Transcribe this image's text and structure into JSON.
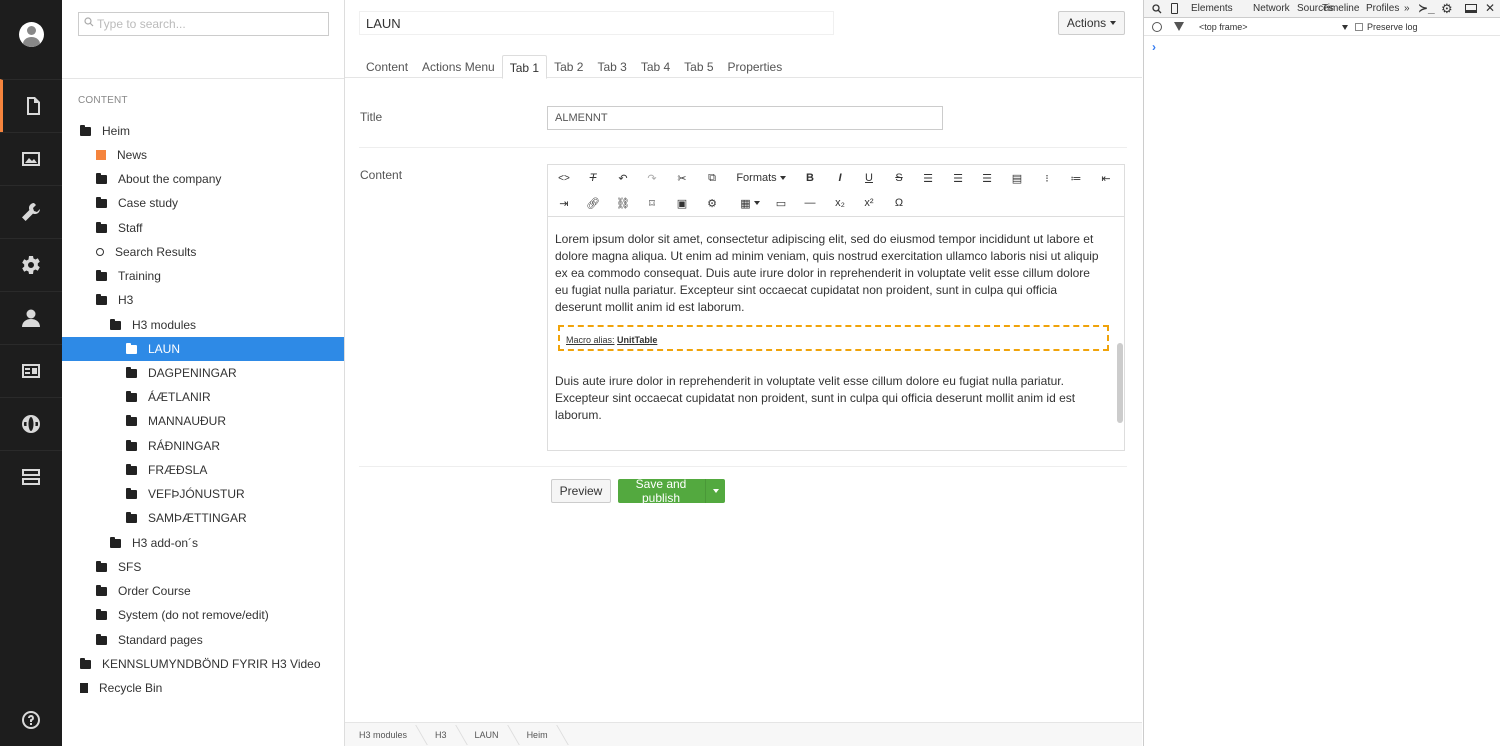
{
  "tree": {
    "search_placeholder": "Type to search...",
    "section": "CONTENT",
    "nodes": [
      {
        "label": "Heim",
        "icon": "home-icon"
      },
      {
        "label": "News",
        "icon": "box-icon"
      },
      {
        "label": "About the company",
        "icon": "folder-icon"
      },
      {
        "label": "Case study",
        "icon": "folder-icon"
      },
      {
        "label": "Staff",
        "icon": "folder-icon"
      },
      {
        "label": "Search Results",
        "icon": "search-icon"
      },
      {
        "label": "Training",
        "icon": "folder-icon"
      },
      {
        "label": "H3",
        "icon": "folder-icon"
      },
      {
        "label": "H3 modules",
        "icon": "folder-icon"
      },
      {
        "label": "LAUN",
        "icon": "folder-icon"
      },
      {
        "label": "DAGPENINGAR",
        "icon": "folder-icon"
      },
      {
        "label": "ÁÆTLANIR",
        "icon": "folder-icon"
      },
      {
        "label": "MANNAUÐUR",
        "icon": "folder-icon"
      },
      {
        "label": "RÁÐNINGAR",
        "icon": "folder-icon"
      },
      {
        "label": "FRÆÐSLA",
        "icon": "folder-icon"
      },
      {
        "label": "VEFÞJÓNUSTUR",
        "icon": "folder-icon"
      },
      {
        "label": "SAMÞÆTTINGAR",
        "icon": "folder-icon"
      },
      {
        "label": "H3 add-on´s",
        "icon": "folder-icon"
      },
      {
        "label": "SFS",
        "icon": "folder-icon"
      },
      {
        "label": "Order Course",
        "icon": "folder-icon"
      },
      {
        "label": "System (do not remove/edit)",
        "icon": "folder-icon"
      },
      {
        "label": "Standard pages",
        "icon": "folder-icon"
      },
      {
        "label": "KENNSLUMYNDBÖND FYRIR H3 Video",
        "icon": "folder-icon"
      },
      {
        "label": "Recycle Bin",
        "icon": "trash-icon"
      }
    ]
  },
  "main": {
    "node_name": "LAUN",
    "actions_label": "Actions",
    "tabs": [
      "Content",
      "Actions Menu",
      "Tab 1",
      "Tab 2",
      "Tab 3",
      "Tab 4",
      "Tab 5",
      "Properties"
    ],
    "active_tab": "Tab 1",
    "title_label": "Title",
    "title_value": "ALMENNT",
    "content_label": "Content",
    "formats_label": "Formats",
    "paragraph1": "Lorem ipsum dolor sit amet, consectetur adipiscing elit, sed do eiusmod tempor incididunt ut labore et dolore magna aliqua. Ut enim ad minim veniam, quis nostrud exercitation ullamco laboris nisi ut aliquip ex ea commodo consequat. Duis aute irure dolor in reprehenderit in voluptate velit esse cillum dolore eu fugiat nulla pariatur. Excepteur sint occaecat cupidatat non proident, sunt in culpa qui officia deserunt mollit anim id est laborum.",
    "macro_prefix": "Macro alias:",
    "macro_alias": "UnitTable",
    "paragraph2": "Duis aute irure dolor in reprehenderit in voluptate velit esse cillum dolore eu fugiat nulla pariatur. Excepteur sint occaecat cupidatat non proident, sunt in culpa qui officia deserunt mollit anim id est laborum.",
    "preview_label": "Preview",
    "save_label": "Save and publish",
    "breadcrumbs": [
      "H3 modules",
      "H3",
      "LAUN",
      "Heim"
    ]
  },
  "devtools": {
    "tabs": [
      "Elements",
      "Network",
      "Sources",
      "Timeline",
      "Profiles",
      "»"
    ],
    "frame": "<top frame>",
    "preserve_log": "Preserve log",
    "prompt": "›"
  },
  "colors": {
    "accent": "#f5843d",
    "selected": "#2e8ae6",
    "save": "#53a93f",
    "macro_border": "#f0a30a"
  }
}
